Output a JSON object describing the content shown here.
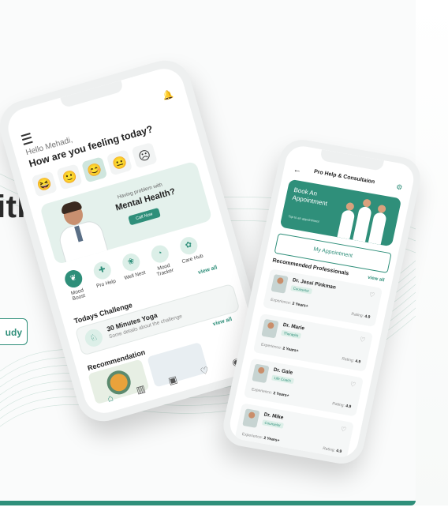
{
  "hero": {
    "headline_fragment": "ith",
    "button_label": "udy"
  },
  "colors": {
    "accent": "#2f8f7a"
  },
  "phone1": {
    "greeting": "Hello Mehadi,",
    "question": "How are you feeling today?",
    "moods": [
      "😆",
      "🙂",
      "😊",
      "😐",
      "☹"
    ],
    "banner": {
      "small": "Having problem with",
      "title": "Mental Health?",
      "button": "Call Now"
    },
    "categories": [
      {
        "label": "Mood Boost",
        "icon": "leaf-icon"
      },
      {
        "label": "Pro Help",
        "icon": "doctor-icon"
      },
      {
        "label": "Well Nest",
        "icon": "nest-icon"
      },
      {
        "label": "Mood Tracker",
        "icon": "tracker-icon"
      },
      {
        "label": "Care Hub",
        "icon": "hub-icon"
      }
    ],
    "categories_view_all": "view all",
    "challenge_title": "Todays Challenge",
    "challenge": {
      "title": "30 Minutes Yoga",
      "subtitle": "Some details about the challenge"
    },
    "challenge_view_all": "view all",
    "recommendation_title": "Recommendation"
  },
  "phone2": {
    "title": "Pro Help & Consultaion",
    "book_title": "Book An Appointment",
    "book_sub": "Tap to an appointment",
    "my_appointment": "My Appointment",
    "recommended_title": "Recommended Professionals",
    "view_all": "view all",
    "doctors": [
      {
        "name": "Dr. Jessi Pinkman",
        "role": "Counselor",
        "experience_label": "Experience:",
        "experience": "2 Years+",
        "rating_label": "Rating:",
        "rating": "4.9"
      },
      {
        "name": "Dr. Marie",
        "role": "Therapist",
        "experience_label": "Experience:",
        "experience": "2 Years+",
        "rating_label": "Rating:",
        "rating": "4.9"
      },
      {
        "name": "Dr. Gale",
        "role": "Life Coach",
        "experience_label": "Experience:",
        "experience": "2 Years+",
        "rating_label": "Rating:",
        "rating": "4.9"
      },
      {
        "name": "Dr. Mike",
        "role": "Counselor",
        "experience_label": "Experience:",
        "experience": "2 Years+",
        "rating_label": "Rating:",
        "rating": "4.9"
      }
    ]
  }
}
